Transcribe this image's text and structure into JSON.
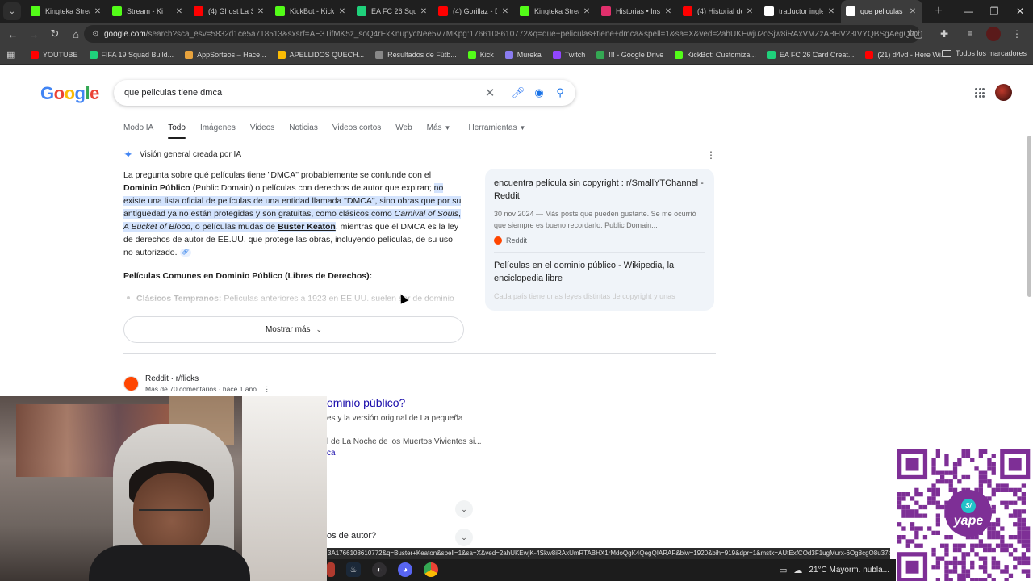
{
  "browser": {
    "tabs": [
      {
        "label": "Kingteka Strea",
        "icon": "kick-icon",
        "color": "#53fc18",
        "active": false
      },
      {
        "label": "Stream - Ki",
        "icon": "kick-icon",
        "color": "#53fc18",
        "active": false
      },
      {
        "label": "(4) Ghost La S",
        "icon": "youtube-icon",
        "color": "#ff0000",
        "active": false
      },
      {
        "label": "KickBot - Kick",
        "icon": "kick-icon",
        "color": "#53fc18",
        "active": false
      },
      {
        "label": "EA FC 26 Squ",
        "icon": "futbin-icon",
        "color": "#1fd17b",
        "active": false
      },
      {
        "label": "(4) Gorillaz - D",
        "icon": "youtube-icon",
        "color": "#ff0000",
        "active": false
      },
      {
        "label": "Kingteka Strea",
        "icon": "kick-icon",
        "color": "#53fc18",
        "active": false
      },
      {
        "label": "Historias • Inst",
        "icon": "instagram-icon",
        "color": "#e1306c",
        "active": false
      },
      {
        "label": "(4) Historial de",
        "icon": "youtube-icon",
        "color": "#ff0000",
        "active": false
      },
      {
        "label": "traductor ingle",
        "icon": "google-icon",
        "color": "#ffffff",
        "active": false
      },
      {
        "label": "que peliculas ti",
        "icon": "google-icon",
        "color": "#ffffff",
        "active": true
      }
    ],
    "url_host": "google.com",
    "url_path": "/search?sca_esv=5832d1ce5a718513&sxsrf=AE3TifMK5z_soQ4rEkKnupycNee5V7MKpg:1766108610772&q=que+peliculas+tiene+dmca&spell=1&sa=X&ved=2ahUKEwju2oSjw8iRAxVMZzABHV23IVYQBSgAegQIDhAB&biw=1...",
    "bookmarks": [
      {
        "label": "YOUTUBE",
        "color": "#ff0000"
      },
      {
        "label": "FIFA 19 Squad Build...",
        "color": "#1fd17b"
      },
      {
        "label": "AppSorteos – Hace...",
        "color": "#e8a33d"
      },
      {
        "label": "APELLIDOS QUECH...",
        "color": "#fbbc05"
      },
      {
        "label": "Resultados de Fútb...",
        "color": "#888888"
      },
      {
        "label": "Kick",
        "color": "#53fc18"
      },
      {
        "label": "Mureka",
        "color": "#8a7cf0"
      },
      {
        "label": "Twitch",
        "color": "#9146ff"
      },
      {
        "label": "!!! - Google Drive",
        "color": "#34a853"
      },
      {
        "label": "KickBot: Customiza...",
        "color": "#53fc18"
      },
      {
        "label": "EA FC 26 Card Creat...",
        "color": "#1fd17b"
      },
      {
        "label": "(21) d4vd - Here Wi...",
        "color": "#ff0000"
      }
    ],
    "all_bookmarks": "Todos los marcadores"
  },
  "google": {
    "logo": "Google",
    "query": "que peliculas tiene dmca",
    "tabs": [
      "Modo IA",
      "Todo",
      "Imágenes",
      "Videos",
      "Noticias",
      "Videos cortos",
      "Web",
      "Más",
      "Herramientas"
    ],
    "ai_overview": {
      "heading": "Visión general creada por IA",
      "t1": "La pregunta sobre qué películas tiene \"DMCA\" probablemente se confunde con el ",
      "b1": "Dominio Público",
      "t2": " (Public Domain) o películas con derechos de autor que expiran; ",
      "hl1": "no existe una lista oficial de películas de una entidad llamada \"DMCA\", sino obras que por su antigüedad ya no están protegidas y son gratuitas, como clásicos como ",
      "i1": "Carnival of Souls",
      "hl2": ", ",
      "i2": "A Bucket of Blood",
      "hl3": ", o películas mudas de ",
      "b2": "Buster Keaton",
      "t3": ", mientras que el DMCA es la ley de derechos de autor de EE.UU. que protege las obras, incluyendo películas, de su uso no autorizado.",
      "subheading": "Películas Comunes en Dominio Público (Libres de Derechos):",
      "faded_bold": "Clásicos Tempranos:",
      "faded_text": " Películas anteriores a 1923 en EE.UU. suelen ser de dominio",
      "show_more": "Mostrar más"
    },
    "sources": [
      {
        "title": "encuentra película sin copyright : r/SmallYTChannel - Reddit",
        "snippet": "30 nov 2024 — Más posts que pueden gustarte. Se me ocurrió que siempre es bueno recordarlo: Public Domain...",
        "site": "Reddit"
      },
      {
        "title": "Películas en el dominio público - Wikipedia, la enciclopedia libre",
        "snippet": "Cada país tiene unas leyes distintas de copyright y unas"
      }
    ],
    "result": {
      "site": "Reddit · r/flicks",
      "meta": "Más de 70 comentarios · hace 1 año",
      "title": "ominio público?",
      "line1": "es y la versión original de La pequeña",
      "line2": "l de La Noche de los Muertos Vivientes si...",
      "link": "ca",
      "faq2": "os de autor?"
    }
  },
  "status_url": "3A1766108610772&q=Buster+Keaton&spell=1&sa=X&ved=2ahUKEwjK-4Skw8iRAxUmRTABHX1rMdoQgK4QegQIARAF&biw=1920&bih=919&dpr=1&mstk=AUtExfCOd3F1ugMurx-6Og8cgO8u37oN",
  "taskbar": {
    "weather": "21°C  Mayorm. nubla..."
  },
  "qr": {
    "brand": "yape",
    "coin": "S/",
    "color": "#7e2f96"
  }
}
